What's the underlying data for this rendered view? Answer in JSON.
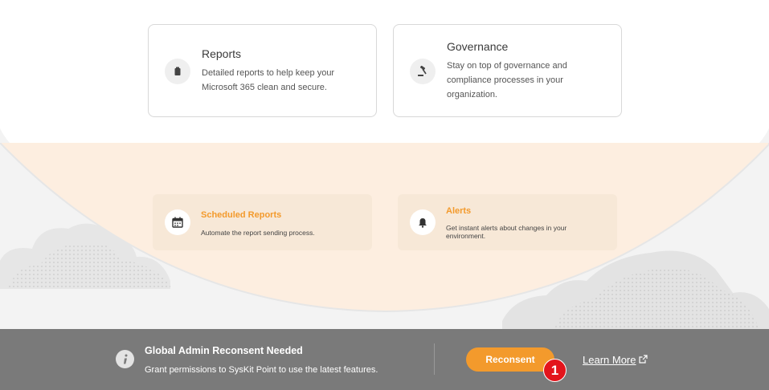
{
  "cards": [
    {
      "title": "Reports",
      "description": "Detailed reports to help keep your Microsoft 365 clean and secure.",
      "icon": "clipboard-icon"
    },
    {
      "title": "Governance",
      "description": "Stay on top of governance and compliance processes in your organization.",
      "icon": "gavel-icon"
    }
  ],
  "features": [
    {
      "title": "Scheduled Reports",
      "description": "Automate the report sending process.",
      "icon": "calendar-icon"
    },
    {
      "title": "Alerts",
      "description": "Get instant alerts about changes in your environment.",
      "icon": "bell-icon"
    }
  ],
  "banner": {
    "title": "Global Admin Reconsent Needed",
    "subtitle": "Grant permissions to SysKit Point to use the latest features.",
    "reconsent_label": "Reconsent",
    "learn_more_label": "Learn More",
    "badge": "1"
  },
  "colors": {
    "accent": "#f39a2c",
    "banner_bg": "#7a7a7a",
    "feature_bg": "#f7e8d7",
    "badge": "#e3141b"
  }
}
